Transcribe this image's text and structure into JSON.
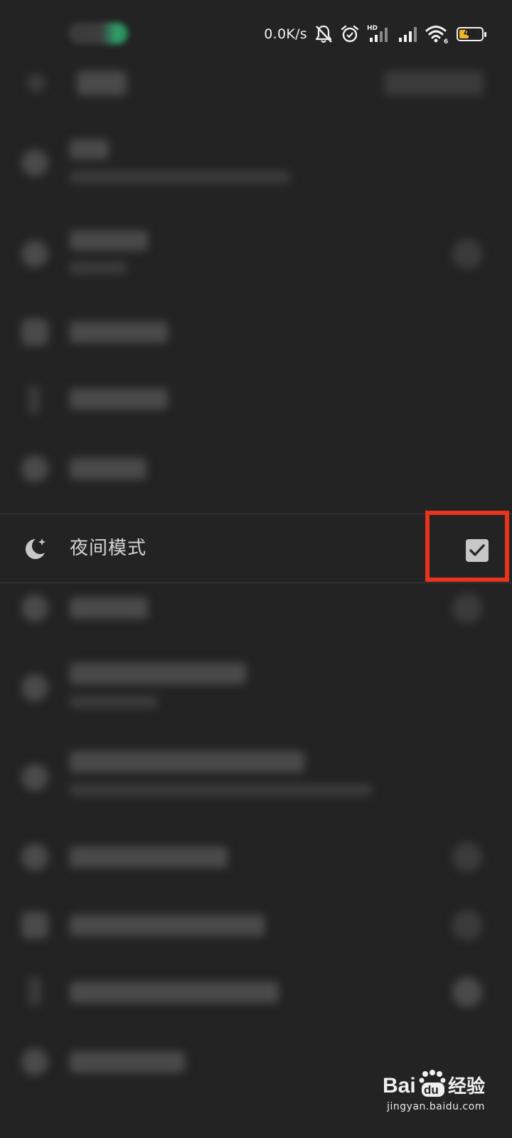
{
  "status_bar": {
    "net_speed": "0.0K/s",
    "hd_label": "HD",
    "wifi_badge": "6",
    "battery_level": "43",
    "battery_fraction": 0.43,
    "battery_color": "#f0b429",
    "icons": [
      "bell-off-icon",
      "alarm-icon",
      "signal-hd-icon",
      "signal-icon",
      "wifi-icon",
      "battery-icon"
    ]
  },
  "settings": {
    "night_mode": {
      "label": "夜间模式",
      "icon": "moon-icon",
      "checked": true
    }
  },
  "highlight": {
    "color": "#e8341c"
  },
  "watermark": {
    "logo_text_bai": "Bai",
    "logo_text_du": "du",
    "logo_text_jingyan": "经验",
    "url": "jingyan.baidu.com"
  }
}
